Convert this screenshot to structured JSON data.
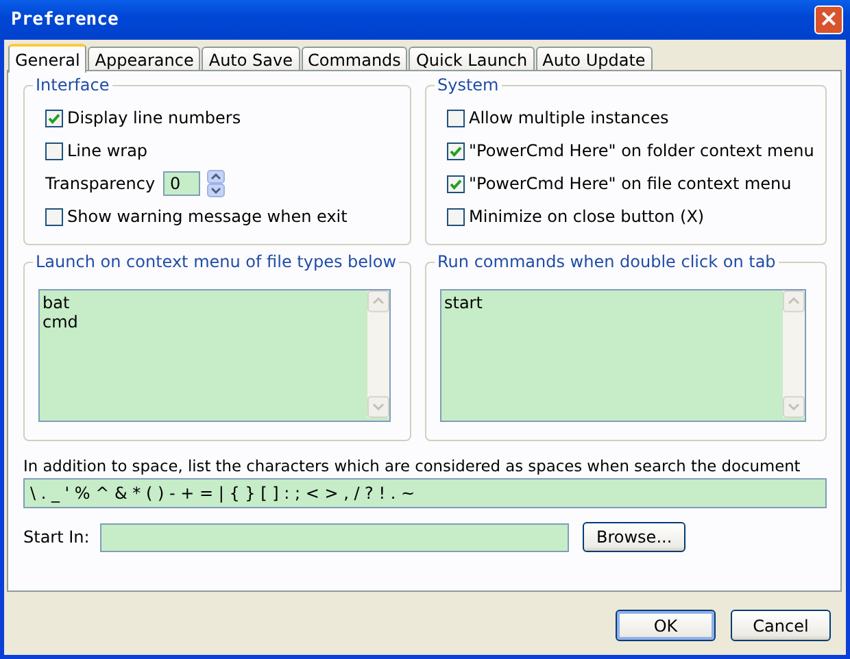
{
  "window": {
    "title": "Preference",
    "close": "×"
  },
  "tabs": [
    {
      "label": "General",
      "selected": true
    },
    {
      "label": "Appearance",
      "selected": false
    },
    {
      "label": "Auto Save",
      "selected": false
    },
    {
      "label": "Commands",
      "selected": false
    },
    {
      "label": "Quick Launch",
      "selected": false
    },
    {
      "label": "Auto Update",
      "selected": false
    }
  ],
  "groups": [
    {
      "title": "Interface",
      "items": [
        {
          "kind": "checkbox",
          "label": "Display line numbers",
          "checked": true
        },
        {
          "kind": "checkbox",
          "label": "Line wrap",
          "checked": false
        },
        {
          "kind": "spinner",
          "label": "Transparency",
          "value": "0"
        },
        {
          "kind": "checkbox",
          "label": "Show warning message when exit",
          "checked": false
        }
      ]
    },
    {
      "title": "System",
      "items": [
        {
          "kind": "checkbox",
          "label": "Allow multiple instances",
          "checked": false
        },
        {
          "kind": "checkbox",
          "label": "\"PowerCmd Here\" on folder context menu",
          "checked": true
        },
        {
          "kind": "checkbox",
          "label": "\"PowerCmd Here\" on file context menu",
          "checked": true
        },
        {
          "kind": "checkbox",
          "label": "Minimize on close button (X)",
          "checked": false
        }
      ]
    }
  ],
  "lists": [
    {
      "title": "Launch on context menu of file types below",
      "lines": [
        "bat",
        "cmd"
      ]
    },
    {
      "title": "Run commands when double click on tab",
      "lines": [
        "start"
      ]
    }
  ],
  "separators": {
    "label": "In addition to space, list the characters  which are considered as spaces when search the document",
    "value": "\\ . _ ' % ^ & * ( ) - + = | { } [ ] : ; < > , / ? ! . ~"
  },
  "start_in": {
    "label": "Start In:",
    "browse": "Browse..."
  },
  "buttons": [
    "OK",
    "Cancel"
  ]
}
